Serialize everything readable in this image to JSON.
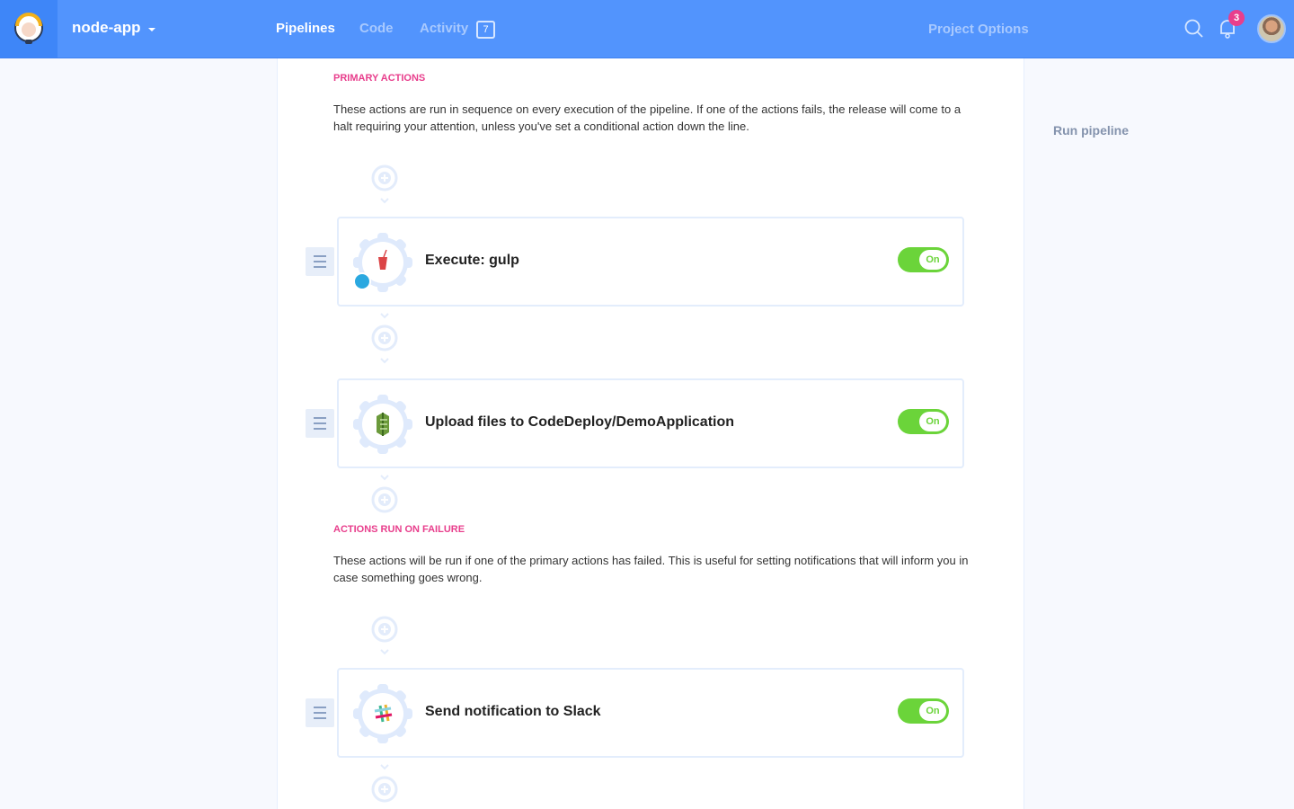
{
  "header": {
    "project_name": "node-app",
    "nav": [
      {
        "label": "Pipelines",
        "active": true
      },
      {
        "label": "Code",
        "active": false
      },
      {
        "label": "Activity",
        "active": false,
        "badge": "7"
      }
    ],
    "project_options": "Project Options",
    "notifications_count": "3"
  },
  "sidebar": {
    "run_pipeline": "Run pipeline"
  },
  "primary": {
    "title": "PRIMARY ACTIONS",
    "description": "These actions are run in sequence on every execution of the pipeline. If one of the actions fails, the release will come to a halt requiring your attention, unless you've set a conditional action down the line.",
    "actions": [
      {
        "name": "Execute: gulp",
        "icon": "gulp-icon",
        "toggle": "On"
      },
      {
        "name": "Upload files to CodeDeploy/DemoApplication",
        "icon": "codedeploy-icon",
        "toggle": "On"
      }
    ]
  },
  "failure": {
    "title": "ACTIONS RUN ON FAILURE",
    "description": "These actions will be run if one of the primary actions has failed. This is useful for setting notifications that will inform you in case something goes wrong.",
    "actions": [
      {
        "name": "Send notification to Slack",
        "icon": "slack-icon",
        "toggle": "On"
      }
    ]
  }
}
